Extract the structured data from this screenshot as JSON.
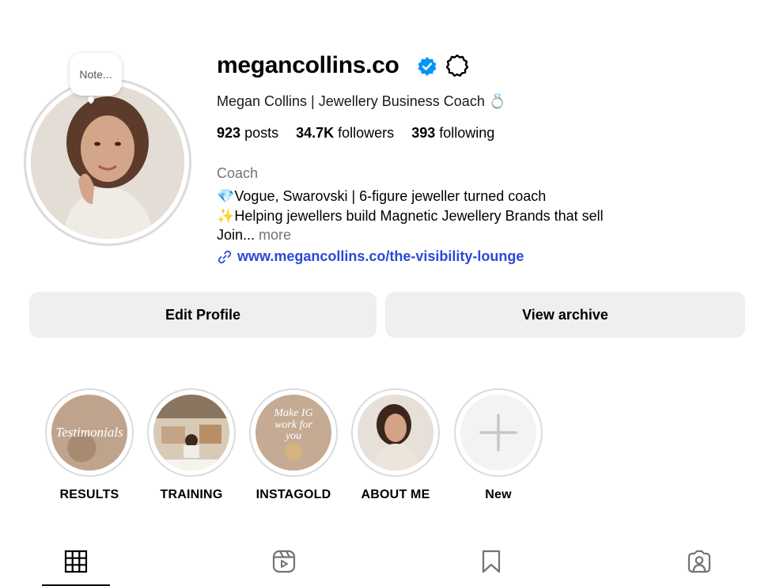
{
  "profile": {
    "username": "megancollins.co",
    "full_name": "Megan Collins | Jewellery Business Coach 💍",
    "note_placeholder": "Note...",
    "category": "Coach",
    "bio": [
      "💎Vogue, Swarovski | 6-figure jeweller turned coach",
      "✨Helping jewellers build Magnetic Jewellery Brands that sell"
    ],
    "bio_truncated": "Join...",
    "more_label": "more",
    "link": "www.megancollins.co/the-visibility-lounge"
  },
  "stats": {
    "posts_count": "923",
    "posts_label": "posts",
    "followers_count": "34.7K",
    "followers_label": "followers",
    "following_count": "393",
    "following_label": "following"
  },
  "buttons": {
    "edit_profile": "Edit Profile",
    "view_archive": "View archive"
  },
  "highlights": [
    {
      "label": "RESULTS",
      "cover_text": "Testimonials",
      "color": "#bfa48d"
    },
    {
      "label": "TRAINING",
      "cover_text": "",
      "color": "#cbb8a2"
    },
    {
      "label": "INSTAGOLD",
      "cover_text": "Make IG work for you",
      "color": "#c5ab94"
    },
    {
      "label": "ABOUT ME",
      "cover_text": "",
      "color": "#d8cfc6"
    },
    {
      "label": "New",
      "cover_text": "",
      "color": "#f3f3f3"
    }
  ],
  "tabs": [
    {
      "name": "posts",
      "icon": "grid-icon",
      "active": true
    },
    {
      "name": "reels",
      "icon": "reels-icon",
      "active": false
    },
    {
      "name": "saved",
      "icon": "bookmark-icon",
      "active": false
    },
    {
      "name": "tagged",
      "icon": "tagged-user-icon",
      "active": false
    }
  ],
  "colors": {
    "link": "#2b49d8",
    "verified": "#0095f6",
    "button_bg": "#efefef",
    "muted_text": "#737373"
  }
}
